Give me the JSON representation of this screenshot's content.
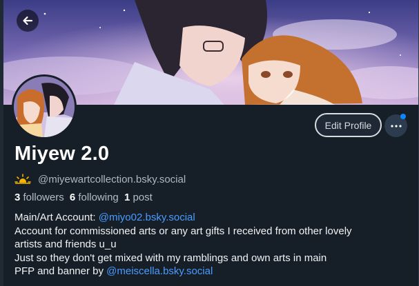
{
  "profile": {
    "display_name": "Miyew 2.0",
    "handle": "@miyewartcollection.bsky.social",
    "handle_emoji_icon": "sun-behind-cloud-icon",
    "stats": {
      "followers_count": "3",
      "followers_label": "followers",
      "following_count": "6",
      "following_label": "following",
      "posts_count": "1",
      "posts_label": "post"
    },
    "bio": {
      "line1_prefix": "Main/Art Account: ",
      "line1_link": "@miyo02.bsky.social",
      "line2": "Account for commissioned arts or any art gifts I received from other lovely",
      "line3": "artists and friends u_u",
      "line4": "Just so they don't get mixed with my ramblings and own arts in main",
      "line5_prefix": "PFP and banner by ",
      "line5_link": "@meiscella.bsky.social"
    }
  },
  "actions": {
    "edit_profile_label": "Edit Profile",
    "more_icon": "ellipsis-icon",
    "back_icon": "arrow-left-icon"
  },
  "colors": {
    "background": "#161e27",
    "link": "#4a9cff",
    "notification_dot": "#1083fe",
    "muted_text": "#aeb6c0"
  }
}
